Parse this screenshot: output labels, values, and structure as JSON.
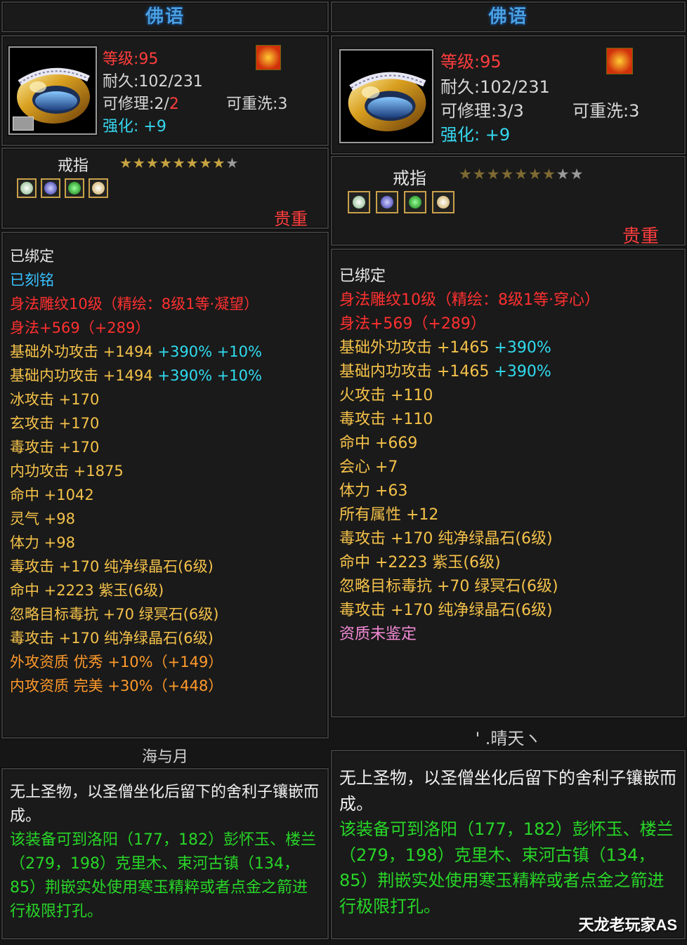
{
  "left": {
    "title": "佛语",
    "level_label": "等级",
    "level_value": ":95",
    "durability": "耐久:102/231",
    "repair_label": "可修理:2/",
    "repair_max": "2",
    "reroll": "可重洗:3",
    "enhance_label": "强化:",
    "enhance_value": "+9",
    "item_type": "戒指",
    "stars_filled": "★★★★★★★★",
    "stars_empty": "★",
    "rarity": "贵重",
    "attributes": [
      {
        "text": "已绑定",
        "color": "c-white"
      },
      {
        "text": "已刻铭",
        "color": "c-blue"
      },
      {
        "text": "身法雕纹10级（精绘：8级1等·凝望）",
        "color": "c-red"
      },
      {
        "text": "身法+569（+289）",
        "color": "c-red"
      },
      {
        "text": "基础外功攻击 +1494 ",
        "color": "c-gold",
        "extra": "+390% +10%"
      },
      {
        "text": "基础内功攻击 +1494 ",
        "color": "c-gold",
        "extra": "+390% +10%"
      },
      {
        "text": "冰攻击 +170",
        "color": "c-gold"
      },
      {
        "text": "玄攻击 +170",
        "color": "c-gold"
      },
      {
        "text": "毒攻击 +170",
        "color": "c-gold"
      },
      {
        "text": "内功攻击 +1875",
        "color": "c-gold"
      },
      {
        "text": "命中 +1042",
        "color": "c-gold"
      },
      {
        "text": "灵气 +98",
        "color": "c-gold"
      },
      {
        "text": "体力 +98",
        "color": "c-gold"
      },
      {
        "text": "毒攻击 +170 纯净绿晶石(6级)",
        "color": "c-gold"
      },
      {
        "text": "命中 +2223 紫玉(6级)",
        "color": "c-gold"
      },
      {
        "text": "忽略目标毒抗 +70 绿冥石(6级)",
        "color": "c-gold"
      },
      {
        "text": "毒攻击 +170 纯净绿晶石(6级)",
        "color": "c-gold"
      },
      {
        "text": "外攻资质  优秀 +10%（+149）",
        "color": "c-orange"
      },
      {
        "text": "内攻资质  完美 +30%（+448）",
        "color": "c-orange"
      }
    ],
    "engraver": "海与月",
    "desc_white": "无上圣物，以圣僧坐化后留下的舍利子镶嵌而成。",
    "desc_green": "该装备可到洛阳（177，182）彭怀玉、楼兰（279，198）克里木、束河古镇（134，85）荆嵌实处使用寒玉精粹或者点金之箭进行极限打孔。"
  },
  "right": {
    "title": "佛语",
    "level_label": "等级",
    "level_value": ":95",
    "durability": "耐久:102/231",
    "repair_label": "可修理:3/3",
    "reroll": "可重洗:3",
    "enhance_label": "强化:",
    "enhance_value": "+9",
    "item_type": "戒指",
    "stars_filled": "★★★★★★★",
    "stars_empty": "★★",
    "rarity": "贵重",
    "attributes": [
      {
        "text": "已绑定",
        "color": "c-white"
      },
      {
        "text": "身法雕纹10级（精绘：8级1等·穿心）",
        "color": "c-red"
      },
      {
        "text": "身法+569（+289）",
        "color": "c-red"
      },
      {
        "text": "基础外功攻击 +1465 ",
        "color": "c-gold",
        "extra": "+390%"
      },
      {
        "text": "基础内功攻击 +1465 ",
        "color": "c-gold",
        "extra": "+390%"
      },
      {
        "text": "火攻击 +110",
        "color": "c-gold"
      },
      {
        "text": "毒攻击 +110",
        "color": "c-gold"
      },
      {
        "text": "命中 +669",
        "color": "c-gold"
      },
      {
        "text": "会心 +7",
        "color": "c-gold"
      },
      {
        "text": "体力 +63",
        "color": "c-gold"
      },
      {
        "text": "所有属性 +12",
        "color": "c-gold"
      },
      {
        "text": "毒攻击 +170 纯净绿晶石(6级)",
        "color": "c-gold"
      },
      {
        "text": "命中 +2223 紫玉(6级)",
        "color": "c-gold"
      },
      {
        "text": "忽略目标毒抗 +70 绿冥石(6级)",
        "color": "c-gold"
      },
      {
        "text": "毒攻击 +170 纯净绿晶石(6级)",
        "color": "c-gold"
      },
      {
        "text": "资质未鉴定",
        "color": "c-pink"
      }
    ],
    "engraver": "' .晴天ヽ",
    "desc_white": "无上圣物，以圣僧坐化后留下的舍利子镶嵌而成。",
    "desc_green": "该装备可到洛阳（177，182）彭怀玉、楼兰（279，198）克里木、束河古镇（134，85）荆嵌实处使用寒玉精粹或者点金之箭进行极限打孔。"
  },
  "watermark": "天龙老玩家AS",
  "icons": [
    "ring-icon",
    "fire-element-icon",
    "bag-icon",
    "gem-white-icon",
    "gem-blue-icon",
    "gem-green-icon",
    "gem-gold-icon"
  ]
}
